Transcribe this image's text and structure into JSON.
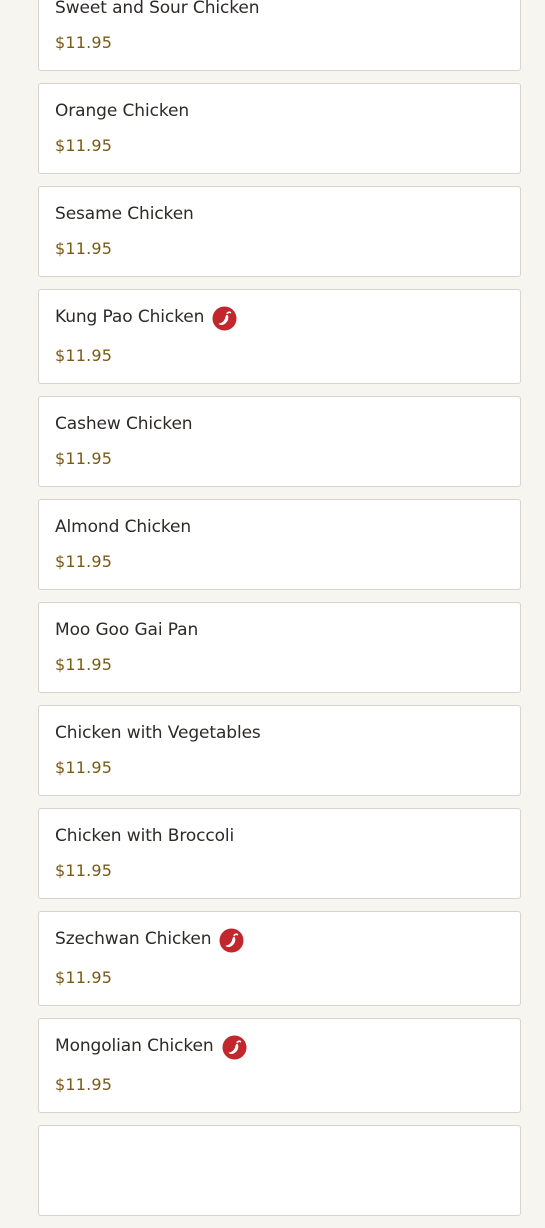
{
  "colors": {
    "page_background": "#f7f5f0",
    "card_background": "#ffffff",
    "card_border": "#d6d4cf",
    "item_name": "#2d2a28",
    "price": "#7a5a14",
    "spicy_badge": "#c1272d"
  },
  "menu": {
    "items": [
      {
        "name": "Sweet and Sour Chicken",
        "price": "$11.95",
        "spicy": false
      },
      {
        "name": "Orange Chicken",
        "price": "$11.95",
        "spicy": false
      },
      {
        "name": "Sesame Chicken",
        "price": "$11.95",
        "spicy": false
      },
      {
        "name": "Kung Pao Chicken",
        "price": "$11.95",
        "spicy": true,
        "icon": "chili-pepper-icon"
      },
      {
        "name": "Cashew Chicken",
        "price": "$11.95",
        "spicy": false
      },
      {
        "name": "Almond Chicken",
        "price": "$11.95",
        "spicy": false
      },
      {
        "name": "Moo Goo Gai Pan",
        "price": "$11.95",
        "spicy": false
      },
      {
        "name": "Chicken with Vegetables",
        "price": "$11.95",
        "spicy": false
      },
      {
        "name": "Chicken with Broccoli",
        "price": "$11.95",
        "spicy": false
      },
      {
        "name": "Szechwan Chicken",
        "price": "$11.95",
        "spicy": true,
        "icon": "chili-pepper-icon"
      },
      {
        "name": "Mongolian Chicken",
        "price": "$11.95",
        "spicy": true,
        "icon": "chili-pepper-icon"
      },
      {
        "name": "",
        "price": "",
        "spicy": false
      }
    ]
  }
}
